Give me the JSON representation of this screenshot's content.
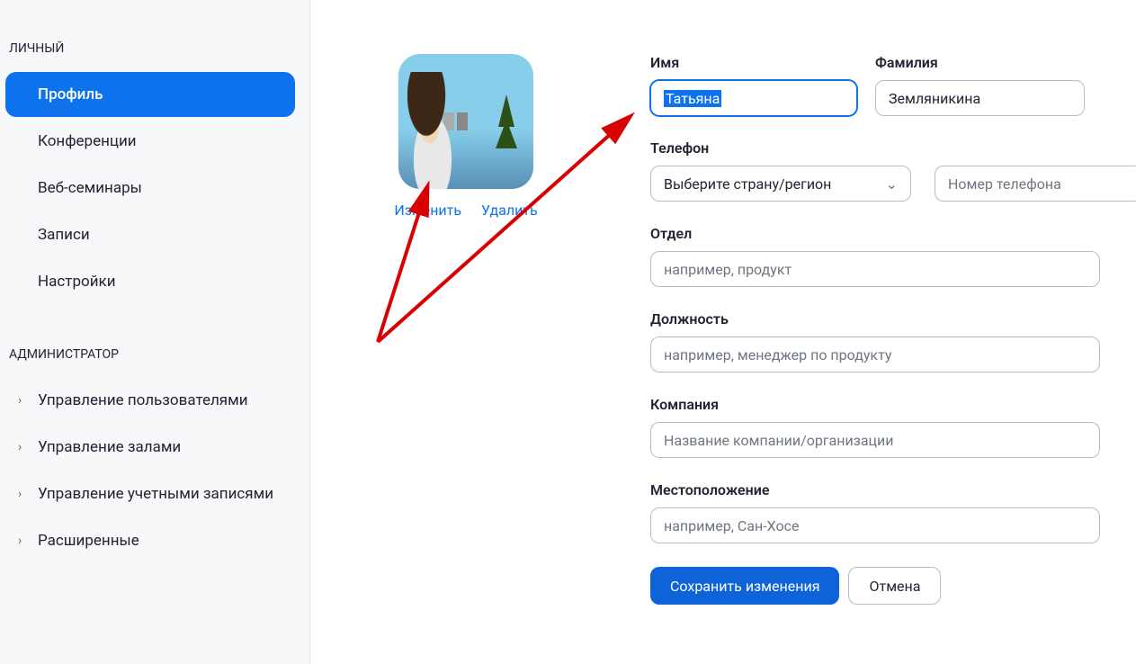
{
  "sidebar": {
    "sections": [
      {
        "title": "ЛИЧНЫЙ",
        "items": [
          {
            "label": "Профиль",
            "active": true
          },
          {
            "label": "Конференции",
            "active": false
          },
          {
            "label": "Веб-семинары",
            "active": false
          },
          {
            "label": "Записи",
            "active": false
          },
          {
            "label": "Настройки",
            "active": false
          }
        ]
      },
      {
        "title": "АДМИНИСТРАТОР",
        "items": [
          {
            "label": "Управление пользователями",
            "active": false,
            "expandable": true
          },
          {
            "label": "Управление залами",
            "active": false,
            "expandable": true
          },
          {
            "label": "Управление учетными записями",
            "active": false,
            "expandable": true
          },
          {
            "label": "Расширенные",
            "active": false,
            "expandable": true
          }
        ]
      }
    ]
  },
  "profile": {
    "avatar": {
      "change_label": "Изменить",
      "delete_label": "Удалить"
    },
    "fields": {
      "first_name": {
        "label": "Имя",
        "value": "Татьяна"
      },
      "last_name": {
        "label": "Фамилия",
        "value": "Земляникина"
      },
      "phone": {
        "label": "Телефон",
        "country_placeholder": "Выберите страну/регион",
        "number_placeholder": "Номер телефона"
      },
      "department": {
        "label": "Отдел",
        "placeholder": "например, продукт"
      },
      "position": {
        "label": "Должность",
        "placeholder": "например, менеджер по продукту"
      },
      "company": {
        "label": "Компания",
        "placeholder": "Название компании/организации"
      },
      "location": {
        "label": "Местоположение",
        "placeholder": "например, Сан-Хосе"
      }
    },
    "actions": {
      "save_label": "Сохранить изменения",
      "cancel_label": "Отмена"
    }
  }
}
